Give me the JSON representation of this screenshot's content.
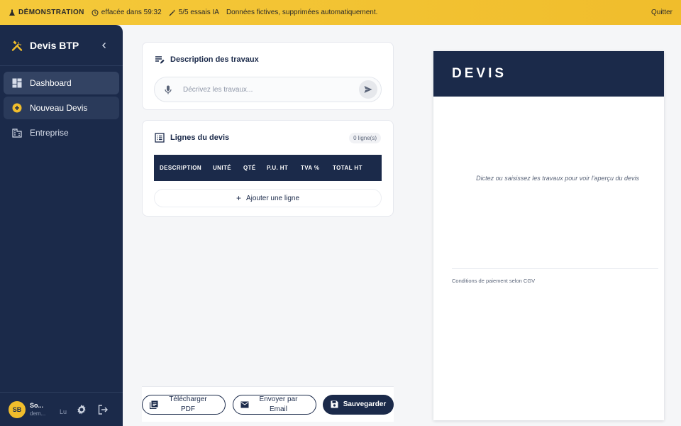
{
  "banner": {
    "mode": "DÉMONSTRATION",
    "timer": "effacée dans 59:32",
    "ai_quota": "5/5 essais IA",
    "notice": "Données fictives, supprimées automatiquement.",
    "quit": "Quitter"
  },
  "sidebar": {
    "brand": "Devis BTP",
    "items": [
      {
        "label": "Dashboard",
        "icon": "dashboard-icon",
        "state": "active"
      },
      {
        "label": "Nouveau Devis",
        "icon": "add-circle-icon",
        "state": "hover"
      },
      {
        "label": "Entreprise",
        "icon": "building-icon",
        "state": "normal"
      }
    ],
    "user": {
      "initials": "SB",
      "name": "So...",
      "email": "dem...",
      "lang": "Lu"
    }
  },
  "description": {
    "title": "Description des travaux",
    "placeholder": "Décrivez les travaux..."
  },
  "lines": {
    "title": "Lignes du devis",
    "count": "0 ligne(s)",
    "columns": [
      "DESCRIPTION",
      "UNITÉ",
      "QTÉ",
      "P.U. HT",
      "TVA %",
      "TOTAL HT"
    ],
    "add_label": "Ajouter une ligne"
  },
  "actions": {
    "pdf_line1": "Télécharger",
    "pdf_line2": "PDF",
    "email_line1": "Envoyer par",
    "email_line2": "Email",
    "save": "Sauvegarder"
  },
  "preview": {
    "title": "DEVIS",
    "empty": "Dictez ou saisissez les travaux pour voir l'aperçu du devis",
    "conditions": "Conditions de paiement selon CGV"
  },
  "colors": {
    "navy": "#1b2a4a",
    "banner": "#f0bd2c",
    "accent": "#f0bd2c"
  }
}
